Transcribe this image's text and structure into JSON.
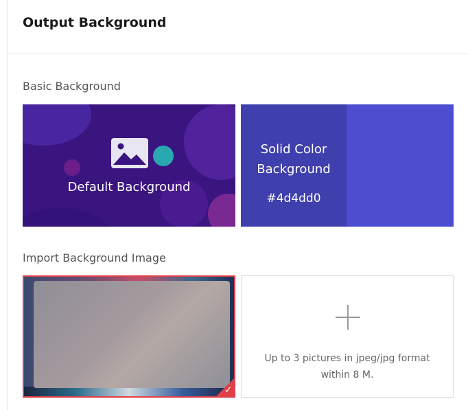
{
  "header": {
    "title": "Output Background"
  },
  "sections": {
    "basic_label": "Basic Background",
    "import_label": "Import Background Image"
  },
  "cards": {
    "default_label": "Default Background",
    "solid_line1": "Solid Color",
    "solid_line2": "Background",
    "solid_hex": "#4d4dd0",
    "upload_hint_line1": "Up to 3 pictures in jpeg/jpg format",
    "upload_hint_line2": "within 8 M."
  },
  "colors": {
    "solid_background": "#4d4dd0",
    "selected_accent": "#e0404a"
  },
  "icons": {
    "default_card": "image-icon",
    "upload_card": "plus-icon",
    "selected_badge": "check-icon"
  }
}
